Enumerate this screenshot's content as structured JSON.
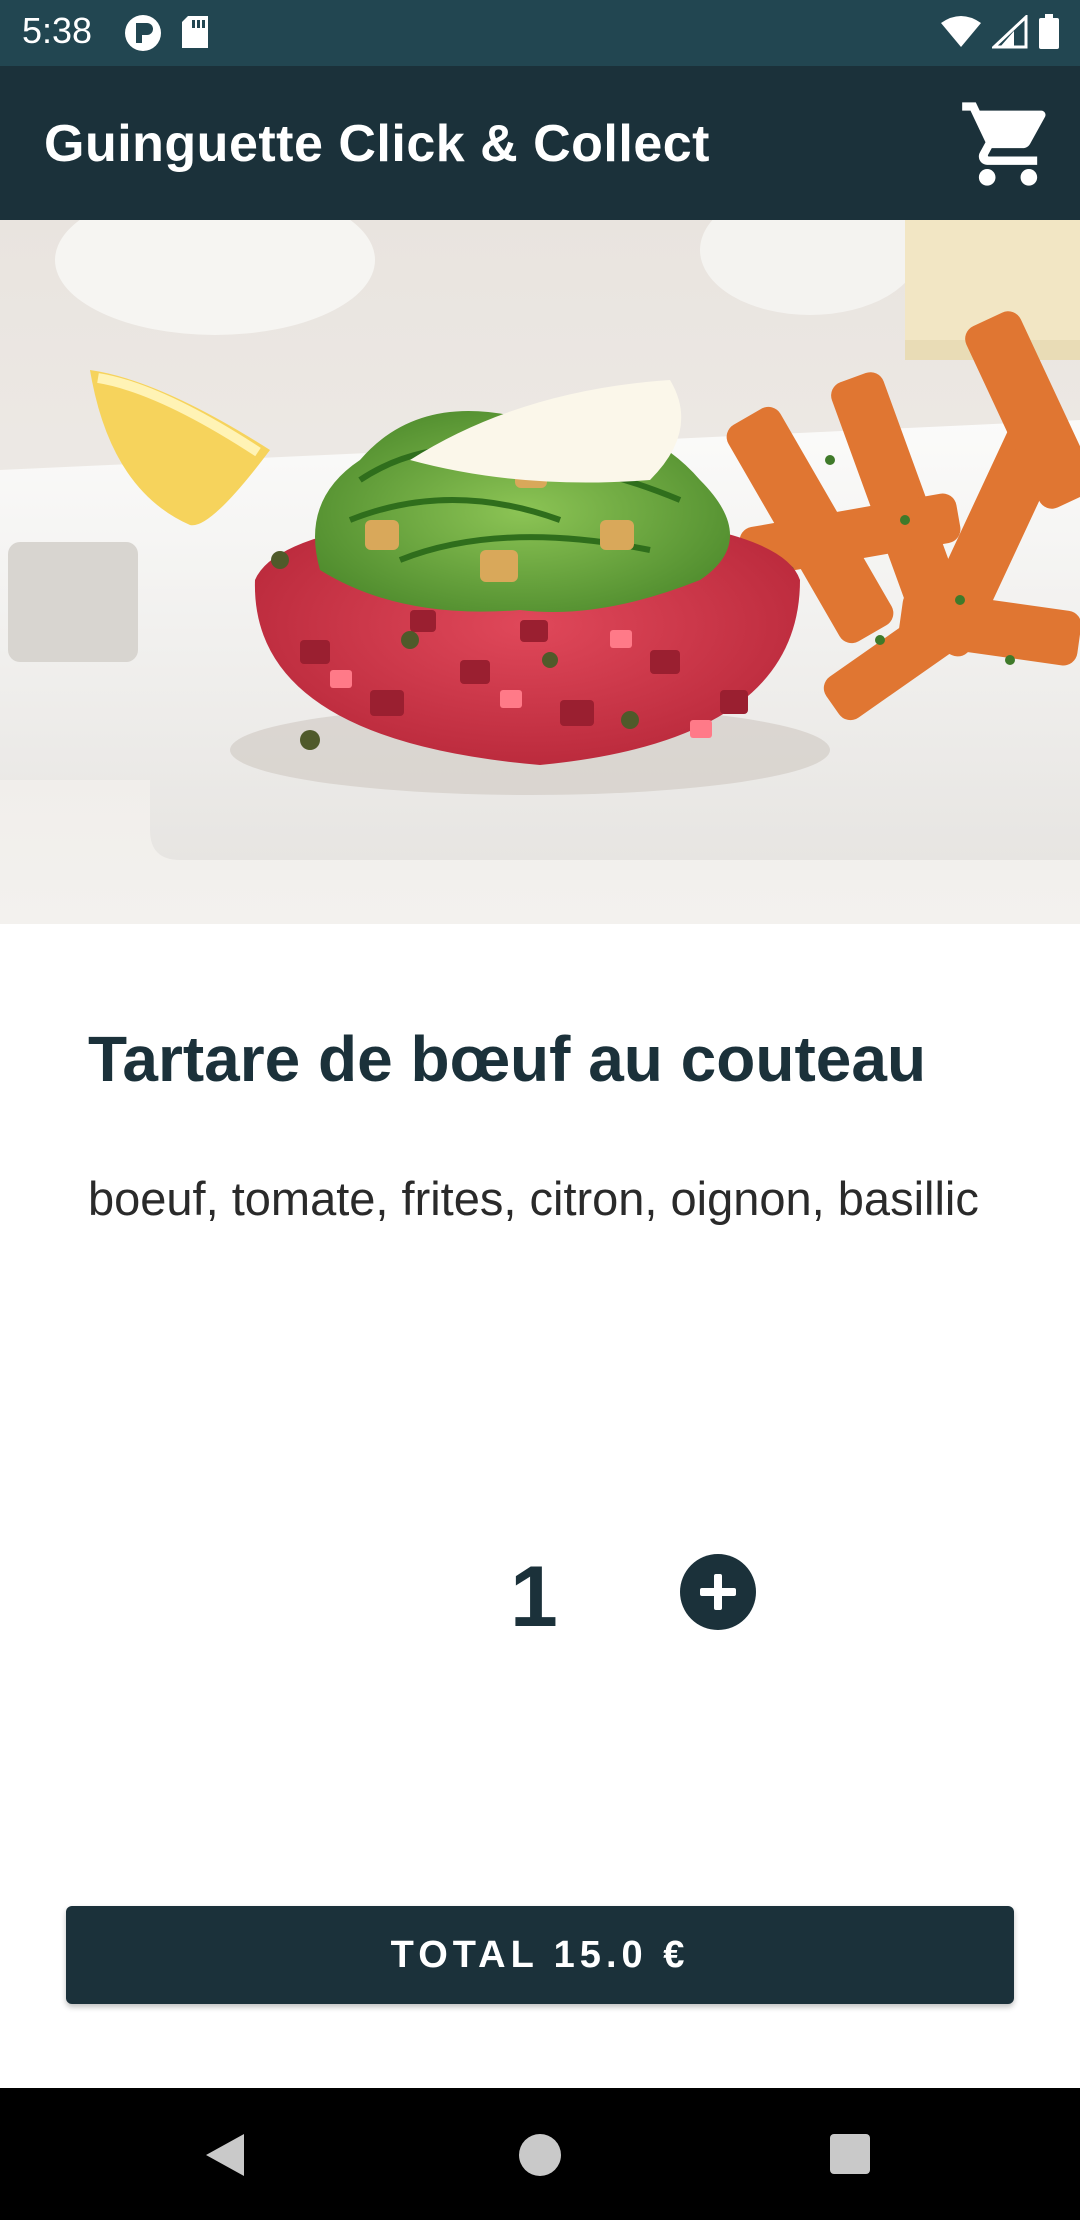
{
  "status_bar": {
    "time": "5:38",
    "left_icons": [
      "p-badge-icon",
      "sd-card-icon"
    ],
    "right_icons": [
      "wifi-icon",
      "signal-icon",
      "battery-icon"
    ]
  },
  "app_bar": {
    "title": "Guinguette Click & Collect",
    "cart_icon": "shopping-cart-icon"
  },
  "dish": {
    "title": "Tartare de bœuf au couteau",
    "description": "boeuf, tomate, frites, citron, oignon, basillic",
    "quantity": "1",
    "add_icon": "plus-circle-icon"
  },
  "total_button": {
    "label": "TOTAL 15.0 €"
  },
  "nav_bar": {
    "back_icon": "back-triangle-icon",
    "home_icon": "home-circle-icon",
    "recent_icon": "recent-square-icon"
  },
  "colors": {
    "primary": "#1b313a",
    "status_bar": "#224651",
    "background": "#ffffff"
  }
}
